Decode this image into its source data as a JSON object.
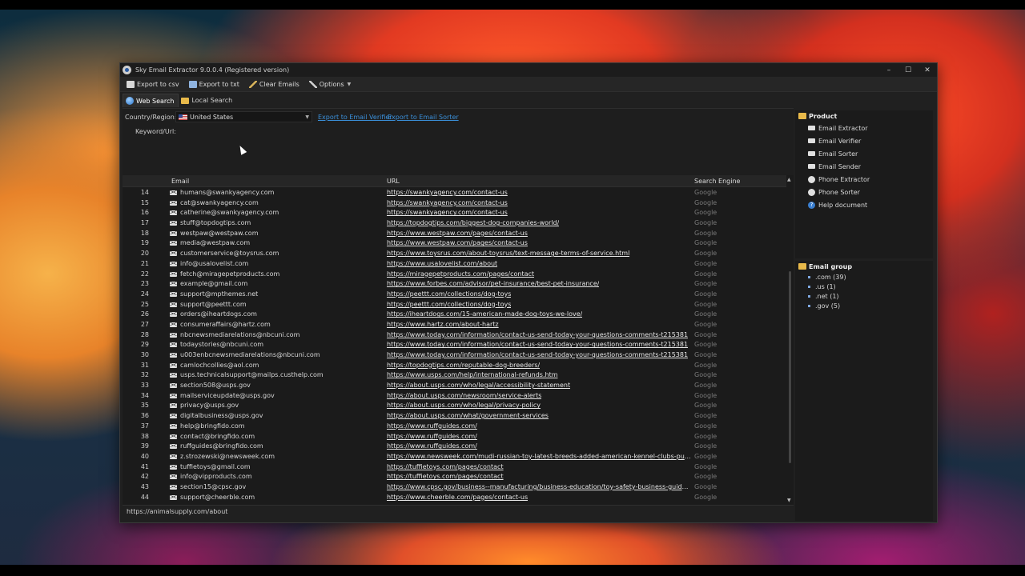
{
  "window": {
    "title": "Sky Email Extractor 9.0.0.4 (Registered version)",
    "controls": [
      "–",
      "☐",
      "✕"
    ]
  },
  "toolbar": {
    "export_csv": "Export to csv",
    "export_txt": "Export to txt",
    "clear_emails": "Clear Emails",
    "options": "Options"
  },
  "tabs": {
    "web_search": "Web Search",
    "local_search": "Local Search"
  },
  "form": {
    "country_label": "Country/Region:",
    "country_value": "United States",
    "export_verifier": "Export to Email Verifier",
    "export_sorter": "Export to Email Sorter",
    "keyword_label": "Keyword/Url:"
  },
  "grid": {
    "columns": [
      "Email",
      "URL",
      "Search Engine"
    ],
    "rows": [
      {
        "n": "14",
        "email": "humans@swankyagency.com",
        "url": "https://swankyagency.com/contact-us",
        "engine": "Google"
      },
      {
        "n": "15",
        "email": "cat@swankyagency.com",
        "url": "https://swankyagency.com/contact-us",
        "engine": "Google"
      },
      {
        "n": "16",
        "email": "catherine@swankyagency.com",
        "url": "https://swankyagency.com/contact-us",
        "engine": "Google"
      },
      {
        "n": "17",
        "email": "stuff@topdogtips.com",
        "url": "https://topdogtips.com/biggest-dog-companies-world/",
        "engine": "Google"
      },
      {
        "n": "18",
        "email": "westpaw@westpaw.com",
        "url": "https://www.westpaw.com/pages/contact-us",
        "engine": "Google"
      },
      {
        "n": "19",
        "email": "media@westpaw.com",
        "url": "https://www.westpaw.com/pages/contact-us",
        "engine": "Google"
      },
      {
        "n": "20",
        "email": "customerservice@toysrus.com",
        "url": "https://www.toysrus.com/about-toysrus/text-message-terms-of-service.html",
        "engine": "Google"
      },
      {
        "n": "21",
        "email": "info@usalovelist.com",
        "url": "https://www.usalovelist.com/about",
        "engine": "Google"
      },
      {
        "n": "22",
        "email": "fetch@miragepetproducts.com",
        "url": "https://miragepetproducts.com/pages/contact",
        "engine": "Google"
      },
      {
        "n": "23",
        "email": "example@gmail.com",
        "url": "https://www.forbes.com/advisor/pet-insurance/best-pet-insurance/",
        "engine": "Google"
      },
      {
        "n": "24",
        "email": "support@mpthemes.net",
        "url": "https://peettt.com/collections/dog-toys",
        "engine": "Google"
      },
      {
        "n": "25",
        "email": "support@peettt.com",
        "url": "https://peettt.com/collections/dog-toys",
        "engine": "Google"
      },
      {
        "n": "26",
        "email": "orders@iheartdogs.com",
        "url": "https://iheartdogs.com/15-american-made-dog-toys-we-love/",
        "engine": "Google"
      },
      {
        "n": "27",
        "email": "consumeraffairs@hartz.com",
        "url": "https://www.hartz.com/about-hartz",
        "engine": "Google"
      },
      {
        "n": "28",
        "email": "nbcnewsmediarelations@nbcuni.com",
        "url": "https://www.today.com/information/contact-us-send-today-your-questions-comments-t215381",
        "engine": "Google"
      },
      {
        "n": "29",
        "email": "todaystories@nbcuni.com",
        "url": "https://www.today.com/information/contact-us-send-today-your-questions-comments-t215381",
        "engine": "Google"
      },
      {
        "n": "30",
        "email": "u003enbcnewsmediarelations@nbcuni.com",
        "url": "https://www.today.com/information/contact-us-send-today-your-questions-comments-t215381",
        "engine": "Google"
      },
      {
        "n": "31",
        "email": "camlochcollies@aol.com",
        "url": "https://topdogtips.com/reputable-dog-breeders/",
        "engine": "Google"
      },
      {
        "n": "32",
        "email": "usps.technicalsupport@mailps.custhelp.com",
        "url": "https://www.usps.com/help/international-refunds.htm",
        "engine": "Google"
      },
      {
        "n": "33",
        "email": "section508@usps.gov",
        "url": "https://about.usps.com/who/legal/accessibility-statement",
        "engine": "Google"
      },
      {
        "n": "34",
        "email": "mailserviceupdate@usps.gov",
        "url": "https://about.usps.com/newsroom/service-alerts",
        "engine": "Google"
      },
      {
        "n": "35",
        "email": "privacy@usps.gov",
        "url": "https://about.usps.com/who/legal/privacy-policy",
        "engine": "Google"
      },
      {
        "n": "36",
        "email": "digitalbusiness@usps.gov",
        "url": "https://about.usps.com/what/government-services",
        "engine": "Google"
      },
      {
        "n": "37",
        "email": "help@bringfido.com",
        "url": "https://www.ruffguides.com/",
        "engine": "Google"
      },
      {
        "n": "38",
        "email": "contact@bringfido.com",
        "url": "https://www.ruffguides.com/",
        "engine": "Google"
      },
      {
        "n": "39",
        "email": "ruffguides@bringfido.com",
        "url": "https://www.ruffguides.com/",
        "engine": "Google"
      },
      {
        "n": "40",
        "email": "z.strozewski@newsweek.com",
        "url": "https://www.newsweek.com/mudi-russian-toy-latest-breeds-added-american-kennel-clubs-purebred-lin...",
        "engine": "Google"
      },
      {
        "n": "41",
        "email": "tuffietoys@gmail.com",
        "url": "https://tuffietoys.com/pages/contact",
        "engine": "Google"
      },
      {
        "n": "42",
        "email": "info@vipproducts.com",
        "url": "https://tuffietoys.com/pages/contact",
        "engine": "Google"
      },
      {
        "n": "43",
        "email": "section15@cpsc.gov",
        "url": "https://www.cpsc.gov/business--manufacturing/business-education/toy-safety-business-guidance-and-s...",
        "engine": "Google"
      },
      {
        "n": "44",
        "email": "support@cheerble.com",
        "url": "https://www.cheerble.com/pages/contact-us",
        "engine": "Google"
      }
    ]
  },
  "status": {
    "text": "https://animalsupply.com/about"
  },
  "product_panel": {
    "title": "Product",
    "items": [
      "Email Extractor",
      "Email Verifier",
      "Email Sorter",
      "Email Sender",
      "Phone Extractor",
      "Phone Sorter",
      "Help document"
    ],
    "icons": [
      "mail-icon",
      "mail-icon",
      "mail-icon",
      "mail-icon",
      "phone-icon",
      "phone-icon",
      "help-icon"
    ]
  },
  "email_group": {
    "title": "Email group",
    "items": [
      ".com (39)",
      ".us (1)",
      ".net (1)",
      ".gov (5)"
    ]
  }
}
